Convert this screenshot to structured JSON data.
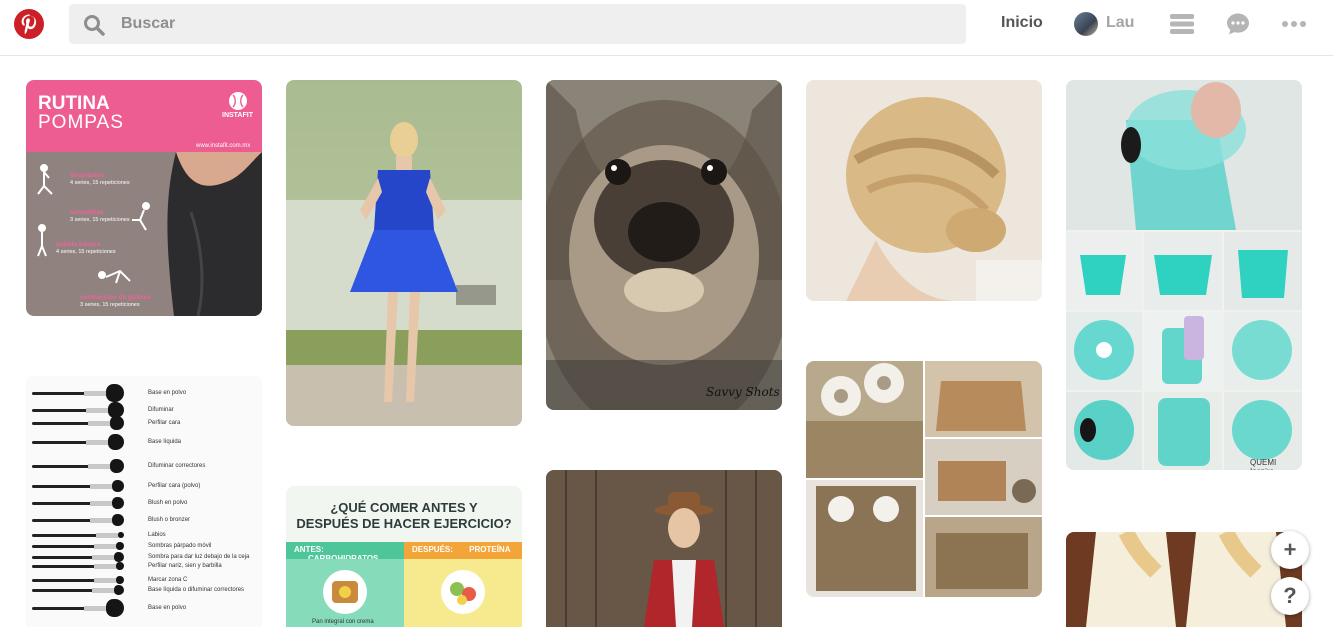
{
  "header": {
    "logo": "pinterest-logo",
    "search_placeholder": "Buscar",
    "nav_home": "Inicio",
    "user_name": "Lau",
    "icons": [
      "search-icon",
      "menu-icon",
      "chat-icon",
      "more-icon"
    ]
  },
  "pins": {
    "rutina": {
      "title": "RUTINA",
      "subtitle": "POMPAS",
      "brand": "INSTAFIT",
      "url": "www.instafit.com.mx",
      "exercises": [
        {
          "name": "desplantes",
          "detail": "4 series, 15 repeticiones"
        },
        {
          "name": "sentadillas",
          "detail": "3 series, 15 repeticiones"
        },
        {
          "name": "patada trasera",
          "detail": "4 series, 15 repeticiones"
        },
        {
          "name": "contracción de glúteos",
          "detail": "3 series, 15 repeticiones"
        }
      ]
    },
    "brushes": {
      "labels": [
        "Base en polvo",
        "Difuminar",
        "Perfilar cara",
        "Base líquida",
        "Difuminar correctores",
        "Perfilar cara (polvo)",
        "Blush en polvo",
        "Blush o bronzer",
        "Labios",
        "Sombras párpado móvil",
        "Sombra para dar luz debajo de la ceja",
        "Perfilar nariz, sien y barbilla",
        "Marcar zona C",
        "Base líquida o difuminar correctores",
        "Base en polvo"
      ]
    },
    "dog": {
      "watermark": "Savvy Shots"
    },
    "jars": {
      "watermark": "QUEMI Inspira"
    },
    "food": {
      "title_line1": "¿QUÉ COMER ANTES Y",
      "title_line2": "DESPUÉS DE HACER EJERCICIO?",
      "before_label": "ANTES:",
      "before_item": "CARBOHIDRATOS",
      "after_label": "DESPUÉS:",
      "after_item": "PROTEÍNA",
      "bottom_text": "Pan integral con crema"
    }
  },
  "fab": {
    "add": "+",
    "help": "?"
  },
  "colors": {
    "brand_red": "#cb2027",
    "rutina_pink": "#ee5d92",
    "food_green": "#4fc59a",
    "food_orange": "#f4a53a"
  }
}
